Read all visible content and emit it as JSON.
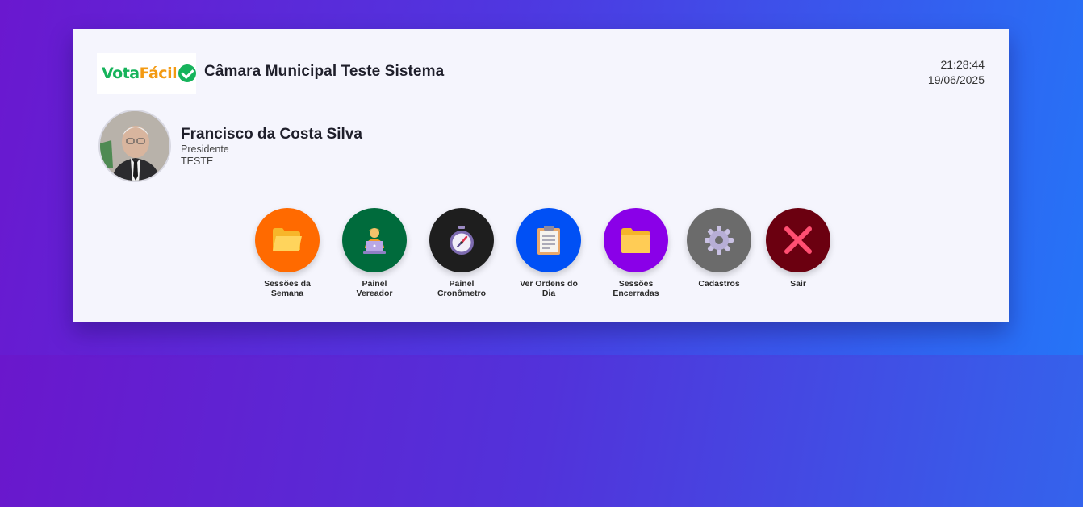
{
  "app": {
    "logo_text_part1": "Vota",
    "logo_text_part2": "Fácil",
    "chamber_name": "Câmara Municipal Teste Sistema",
    "time": "21:28:44",
    "date": "19/06/2025"
  },
  "user": {
    "name": "Francisco da Costa Silva",
    "role": "Presidente",
    "party": "TESTE"
  },
  "menu": [
    {
      "label_line1": "Sessões da",
      "label_line2": "Semana",
      "icon": "open-folder-icon",
      "color": "#ff6a00"
    },
    {
      "label_line1": "Painel",
      "label_line2": "Vereador",
      "icon": "person-laptop-icon",
      "color": "#006b3c"
    },
    {
      "label_line1": "Painel",
      "label_line2": "Cronômetro",
      "icon": "stopwatch-icon",
      "color": "#1e1e1e"
    },
    {
      "label_line1": "Ver Ordens do",
      "label_line2": "Dia",
      "icon": "clipboard-icon",
      "color": "#0050f5"
    },
    {
      "label_line1": "Sessões",
      "label_line2": "Encerradas",
      "icon": "folder-icon",
      "color": "#8a00e8"
    },
    {
      "label_line1": "Cadastros",
      "label_line2": "",
      "icon": "gear-icon",
      "color": "#6b6b6b"
    },
    {
      "label_line1": "Sair",
      "label_line2": "",
      "icon": "close-icon",
      "color": "#6b0010"
    }
  ],
  "colors": {
    "card_bg": "#f5f5fd",
    "brand_green": "#16b35b",
    "brand_orange": "#f39a12"
  }
}
